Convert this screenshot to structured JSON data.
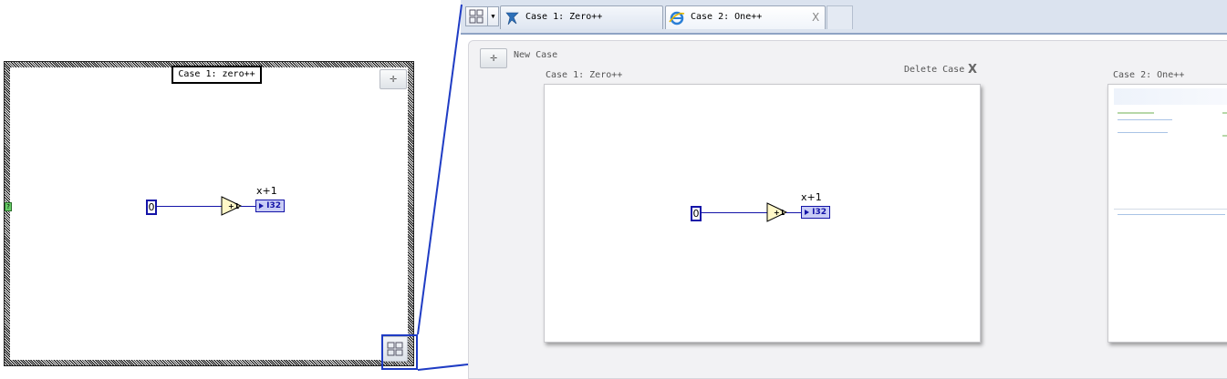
{
  "left_case": {
    "selector_label": "Case 1: zero++",
    "add_button_glyph": "✛",
    "case_terminal_glyph": "?",
    "constant_value": "0",
    "increment_symbol": "+1",
    "indicator_label": "x+1",
    "indicator_type": "I32",
    "grid_button_icon": "grid-icon"
  },
  "tabs": [
    {
      "label": "Case 1: Zero++",
      "icon": "labview-icon",
      "active": false
    },
    {
      "label": "Case 2: One++",
      "icon": "ie-icon",
      "active": true,
      "close": "X"
    }
  ],
  "content": {
    "new_case_button_glyph": "✛",
    "new_case_label": "New Case",
    "case1_caption": "Case 1: Zero++",
    "delete_case_label": "Delete Case",
    "delete_case_x": "X",
    "case1_diagram": {
      "constant_value": "0",
      "increment_symbol": "+1",
      "indicator_label": "x+1",
      "indicator_type": "I32"
    },
    "case2_caption": "Case 2: One++"
  },
  "colors": {
    "wire_blue": "#1414a8",
    "highlight_blue": "#1f3cc4",
    "tabbar_bg": "#dbe3ef",
    "panel_bg": "#f2f2f4"
  }
}
